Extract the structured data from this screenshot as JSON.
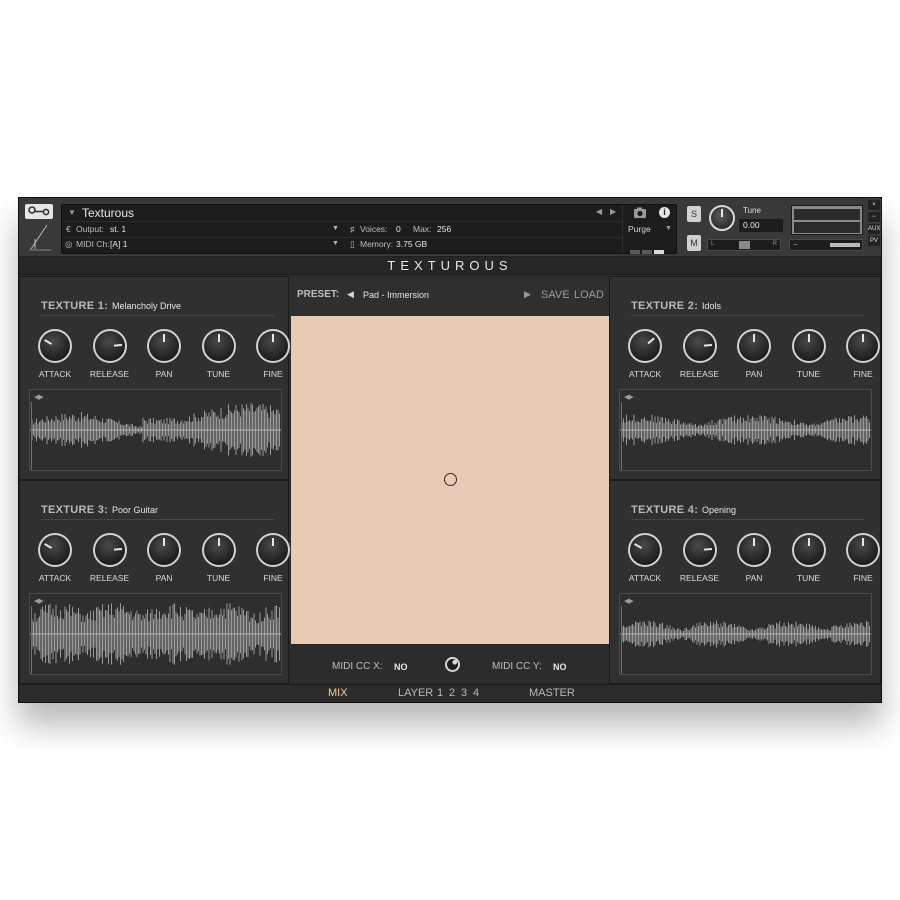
{
  "header": {
    "instrument_name": "Texturous",
    "output_label": "Output:",
    "output_value": "st. 1",
    "midi_label": "MIDI Ch:",
    "midi_value": "[A]  1",
    "voices_label": "Voices:",
    "voices_value": "0",
    "max_label": "Max:",
    "max_value": "256",
    "memory_label": "Memory:",
    "memory_value": "3.75 GB",
    "purge_label": "Purge",
    "solo_label": "S",
    "mute_label": "M",
    "tune_label": "Tune",
    "tune_value": "0.00",
    "pan_left": "L",
    "pan_right": "R",
    "vol_minus": "−",
    "vol_plus": "+",
    "close_label": "×",
    "minimize_label": "−",
    "aux_label": "AUX",
    "pv_label": "PV"
  },
  "title": "TEXTUROUS",
  "textures": [
    {
      "label": "TEXTURE 1:",
      "name": "Melancholy Drive",
      "knobs": [
        {
          "label": "ATTACK",
          "angle": -60
        },
        {
          "label": "RELEASE",
          "angle": 85
        },
        {
          "label": "PAN",
          "angle": 0
        },
        {
          "label": "TUNE",
          "angle": 0
        },
        {
          "label": "FINE",
          "angle": 0
        }
      ]
    },
    {
      "label": "TEXTURE 2:",
      "name": "Idols",
      "knobs": [
        {
          "label": "ATTACK",
          "angle": 50
        },
        {
          "label": "RELEASE",
          "angle": 85
        },
        {
          "label": "PAN",
          "angle": 0
        },
        {
          "label": "TUNE",
          "angle": 0
        },
        {
          "label": "FINE",
          "angle": 0
        }
      ]
    },
    {
      "label": "TEXTURE 3:",
      "name": "Poor Guitar",
      "knobs": [
        {
          "label": "ATTACK",
          "angle": -60
        },
        {
          "label": "RELEASE",
          "angle": 85
        },
        {
          "label": "PAN",
          "angle": 0
        },
        {
          "label": "TUNE",
          "angle": 0
        },
        {
          "label": "FINE",
          "angle": 0
        }
      ]
    },
    {
      "label": "TEXTURE 4:",
      "name": "Opening",
      "knobs": [
        {
          "label": "ATTACK",
          "angle": -60
        },
        {
          "label": "RELEASE",
          "angle": 85
        },
        {
          "label": "PAN",
          "angle": 0
        },
        {
          "label": "TUNE",
          "angle": 0
        },
        {
          "label": "FINE",
          "angle": 0
        }
      ]
    }
  ],
  "preset": {
    "label": "PRESET:",
    "name": "Pad - Immersion",
    "save_label": "SAVE",
    "load_label": "LOAD"
  },
  "xy_pad": {
    "color": "#e8cbb4",
    "cursor_x": 0.5,
    "cursor_y": 0.5
  },
  "midi_cc": {
    "x_label": "MIDI CC X:",
    "x_value": "NO",
    "y_label": "MIDI CC Y:",
    "y_value": "NO"
  },
  "tabs": {
    "mix": "MIX",
    "layer": "LAYER",
    "layer_numbers": [
      "1",
      "2",
      "3",
      "4"
    ],
    "master": "MASTER",
    "active": "MIX",
    "active_color": "#f2c9a6"
  },
  "icons": {
    "wrench": "wrench-icon",
    "camera": "camera-icon",
    "info": "info-icon",
    "kontakt_logo": "kontakt-logo-icon",
    "play": "play-icon"
  }
}
